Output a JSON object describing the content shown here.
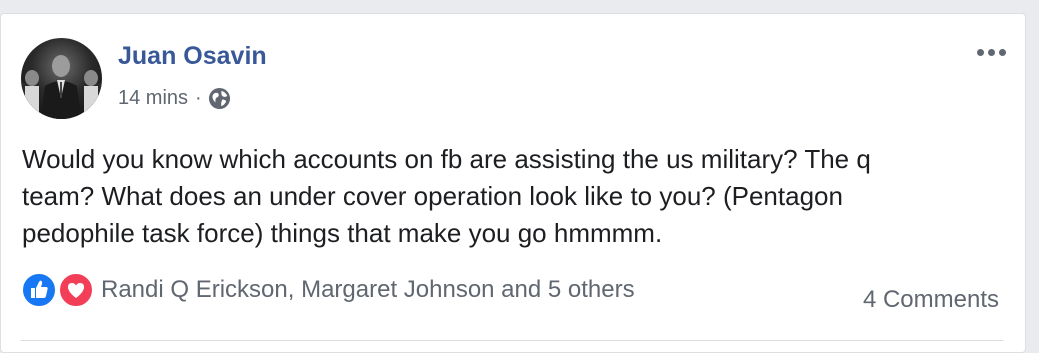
{
  "post": {
    "author": "Juan Osavin",
    "time": "14 mins",
    "separator": "·",
    "privacy_icon": "globe-icon",
    "body_lines": [
      "Would you know which accounts on fb are assisting the us military? The q",
      "team? What does an under cover operation look like to you? (Pentagon",
      "pedophile task force) things that make you go hmmmm."
    ]
  },
  "reactions": {
    "icons": [
      "like-icon",
      "love-icon"
    ],
    "text": "Randi Q Erickson, Margaret Johnson and 5 others"
  },
  "comments": {
    "label": "4 Comments"
  },
  "menu": {
    "icon": "more-options-icon"
  },
  "colors": {
    "author": "#385898",
    "like": "#1877f2",
    "love": "#f33e58",
    "secondary_text": "#606770",
    "body_text": "#1c1e21"
  }
}
